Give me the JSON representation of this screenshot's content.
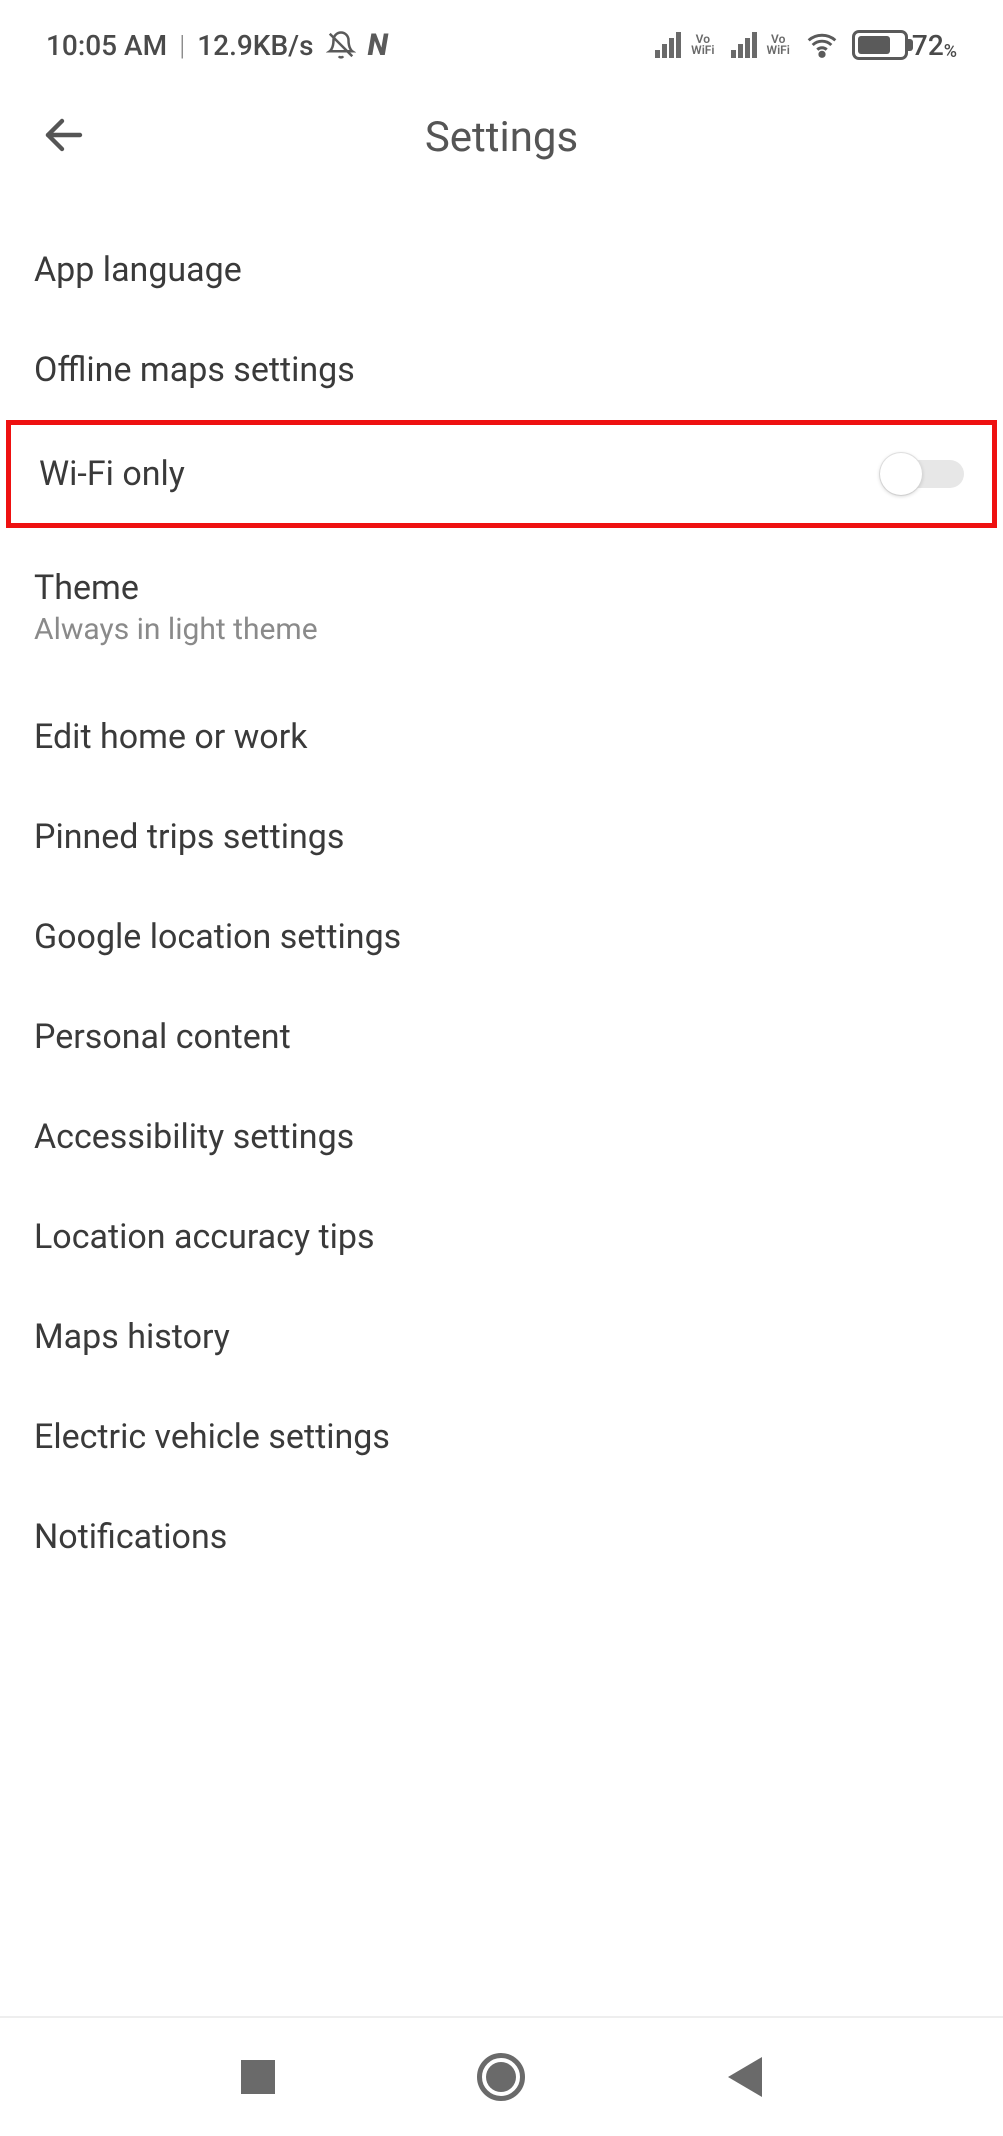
{
  "status": {
    "time": "10:05 AM",
    "speed": "12.9KB/s",
    "vowifi_top": "Vo",
    "vowifi_bottom": "WiFi",
    "battery_pct": "72",
    "battery_pct_unit": "%"
  },
  "header": {
    "title": "Settings"
  },
  "rows": {
    "app_language": "App language",
    "offline_maps": "Offline maps settings",
    "wifi_only": "Wi-Fi only",
    "theme": "Theme",
    "theme_sub": "Always in light theme",
    "edit_home_work": "Edit home or work",
    "pinned_trips": "Pinned trips settings",
    "google_location": "Google location settings",
    "personal_content": "Personal content",
    "accessibility": "Accessibility settings",
    "location_tips": "Location accuracy tips",
    "maps_history": "Maps history",
    "ev_settings": "Electric vehicle settings",
    "notifications": "Notifications"
  },
  "toggles": {
    "wifi_only": false
  }
}
